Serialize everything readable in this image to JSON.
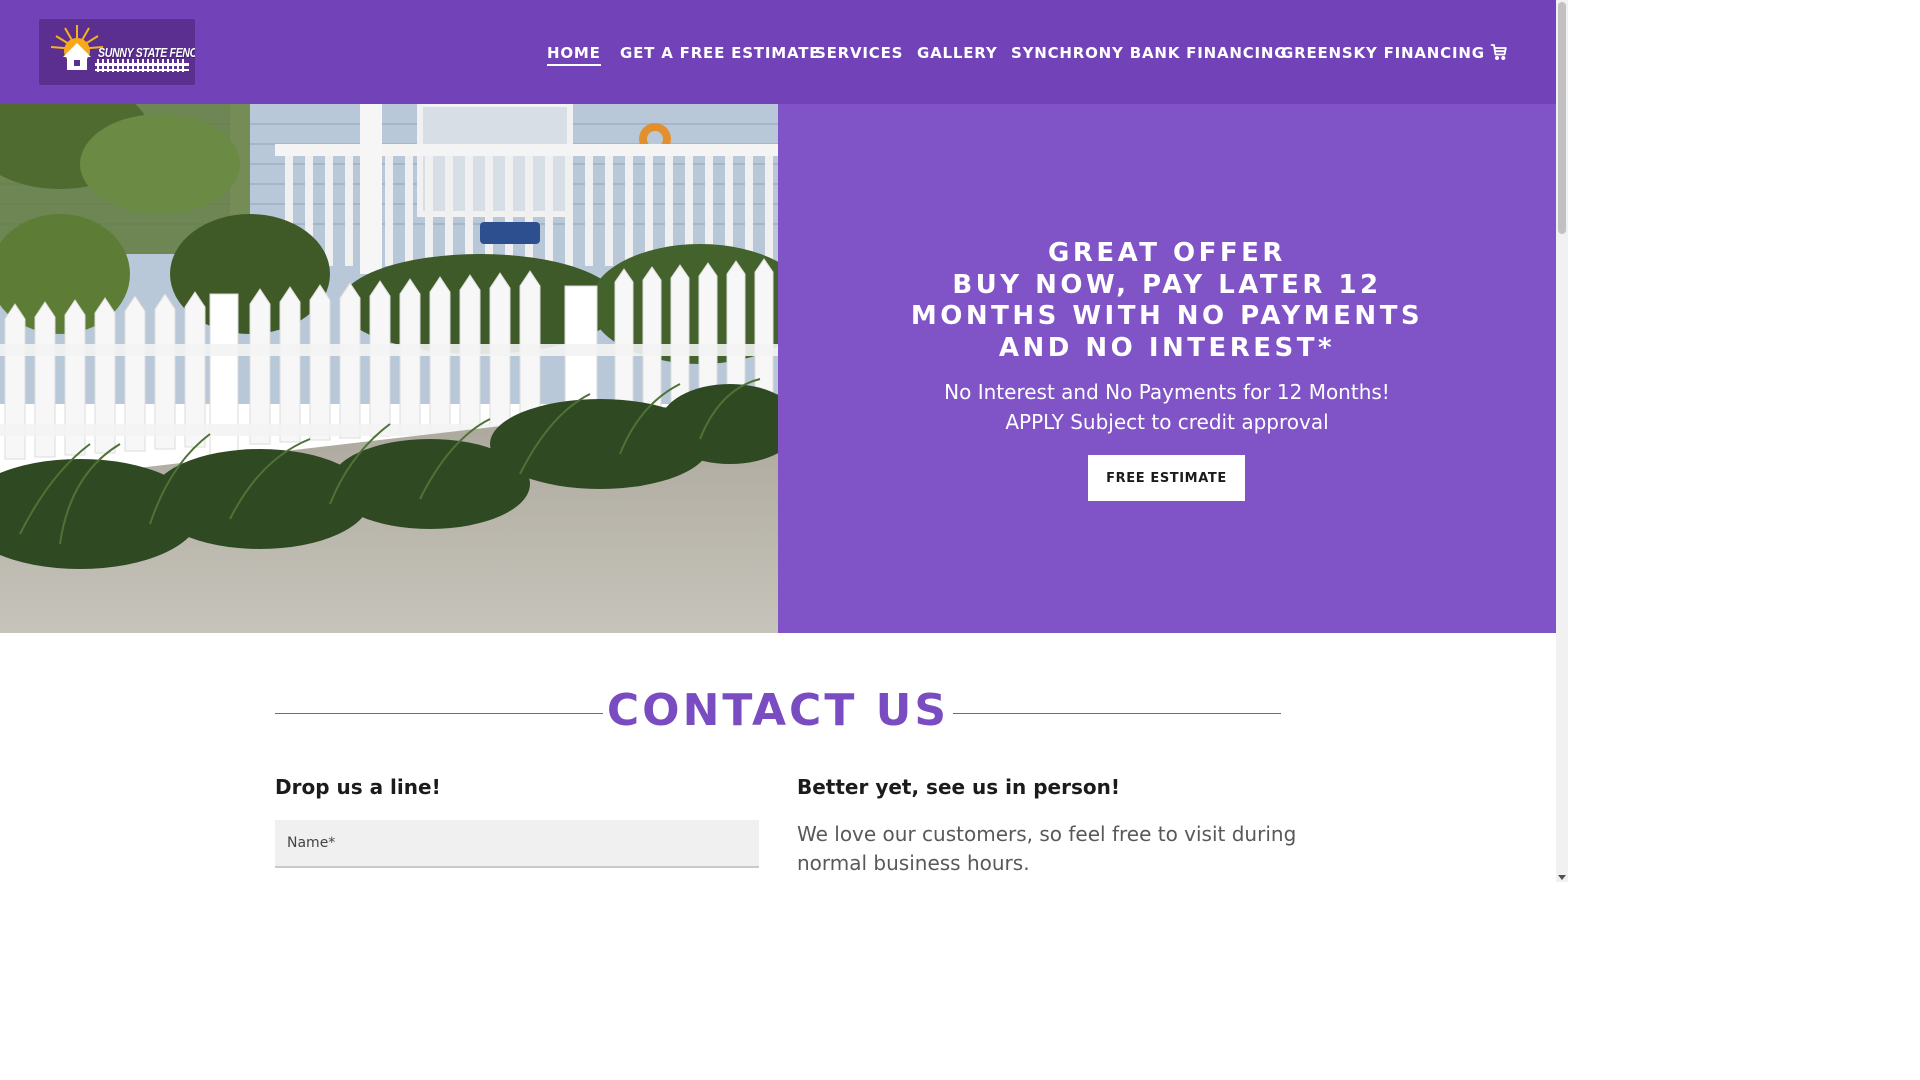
{
  "header": {
    "logo_text": "SUNNY STATE FENCE",
    "nav": [
      {
        "label": "HOME",
        "active": true
      },
      {
        "label": "GET A FREE ESTIMATE",
        "active": false
      },
      {
        "label": "SERVICES",
        "active": false
      },
      {
        "label": "GALLERY",
        "active": false
      },
      {
        "label": "SYNCHRONY BANK FINANCING",
        "active": false
      },
      {
        "label": "GREENSKY FINANCING",
        "active": false
      }
    ],
    "cart_icon": "shopping-cart-icon"
  },
  "hero": {
    "heading_lines": [
      "GREAT OFFER",
      "BUY NOW, PAY LATER 12",
      "MONTHS WITH NO PAYMENTS",
      "AND NO INTEREST*"
    ],
    "sub_lines": [
      "No Interest and No Payments for 12 Months!",
      "APPLY Subject to credit approval"
    ],
    "button_label": "FREE ESTIMATE"
  },
  "contact": {
    "title": "CONTACT US",
    "left_heading": "Drop us a line!",
    "name_placeholder": "Name*",
    "right_heading": "Better yet, see us in person!",
    "visit_text": "We love our customers, so feel free to visit during normal business hours."
  },
  "colors": {
    "header_bg": "#7243b8",
    "hero_panel_bg": "#8054c7",
    "accent": "#7a4cc2"
  }
}
